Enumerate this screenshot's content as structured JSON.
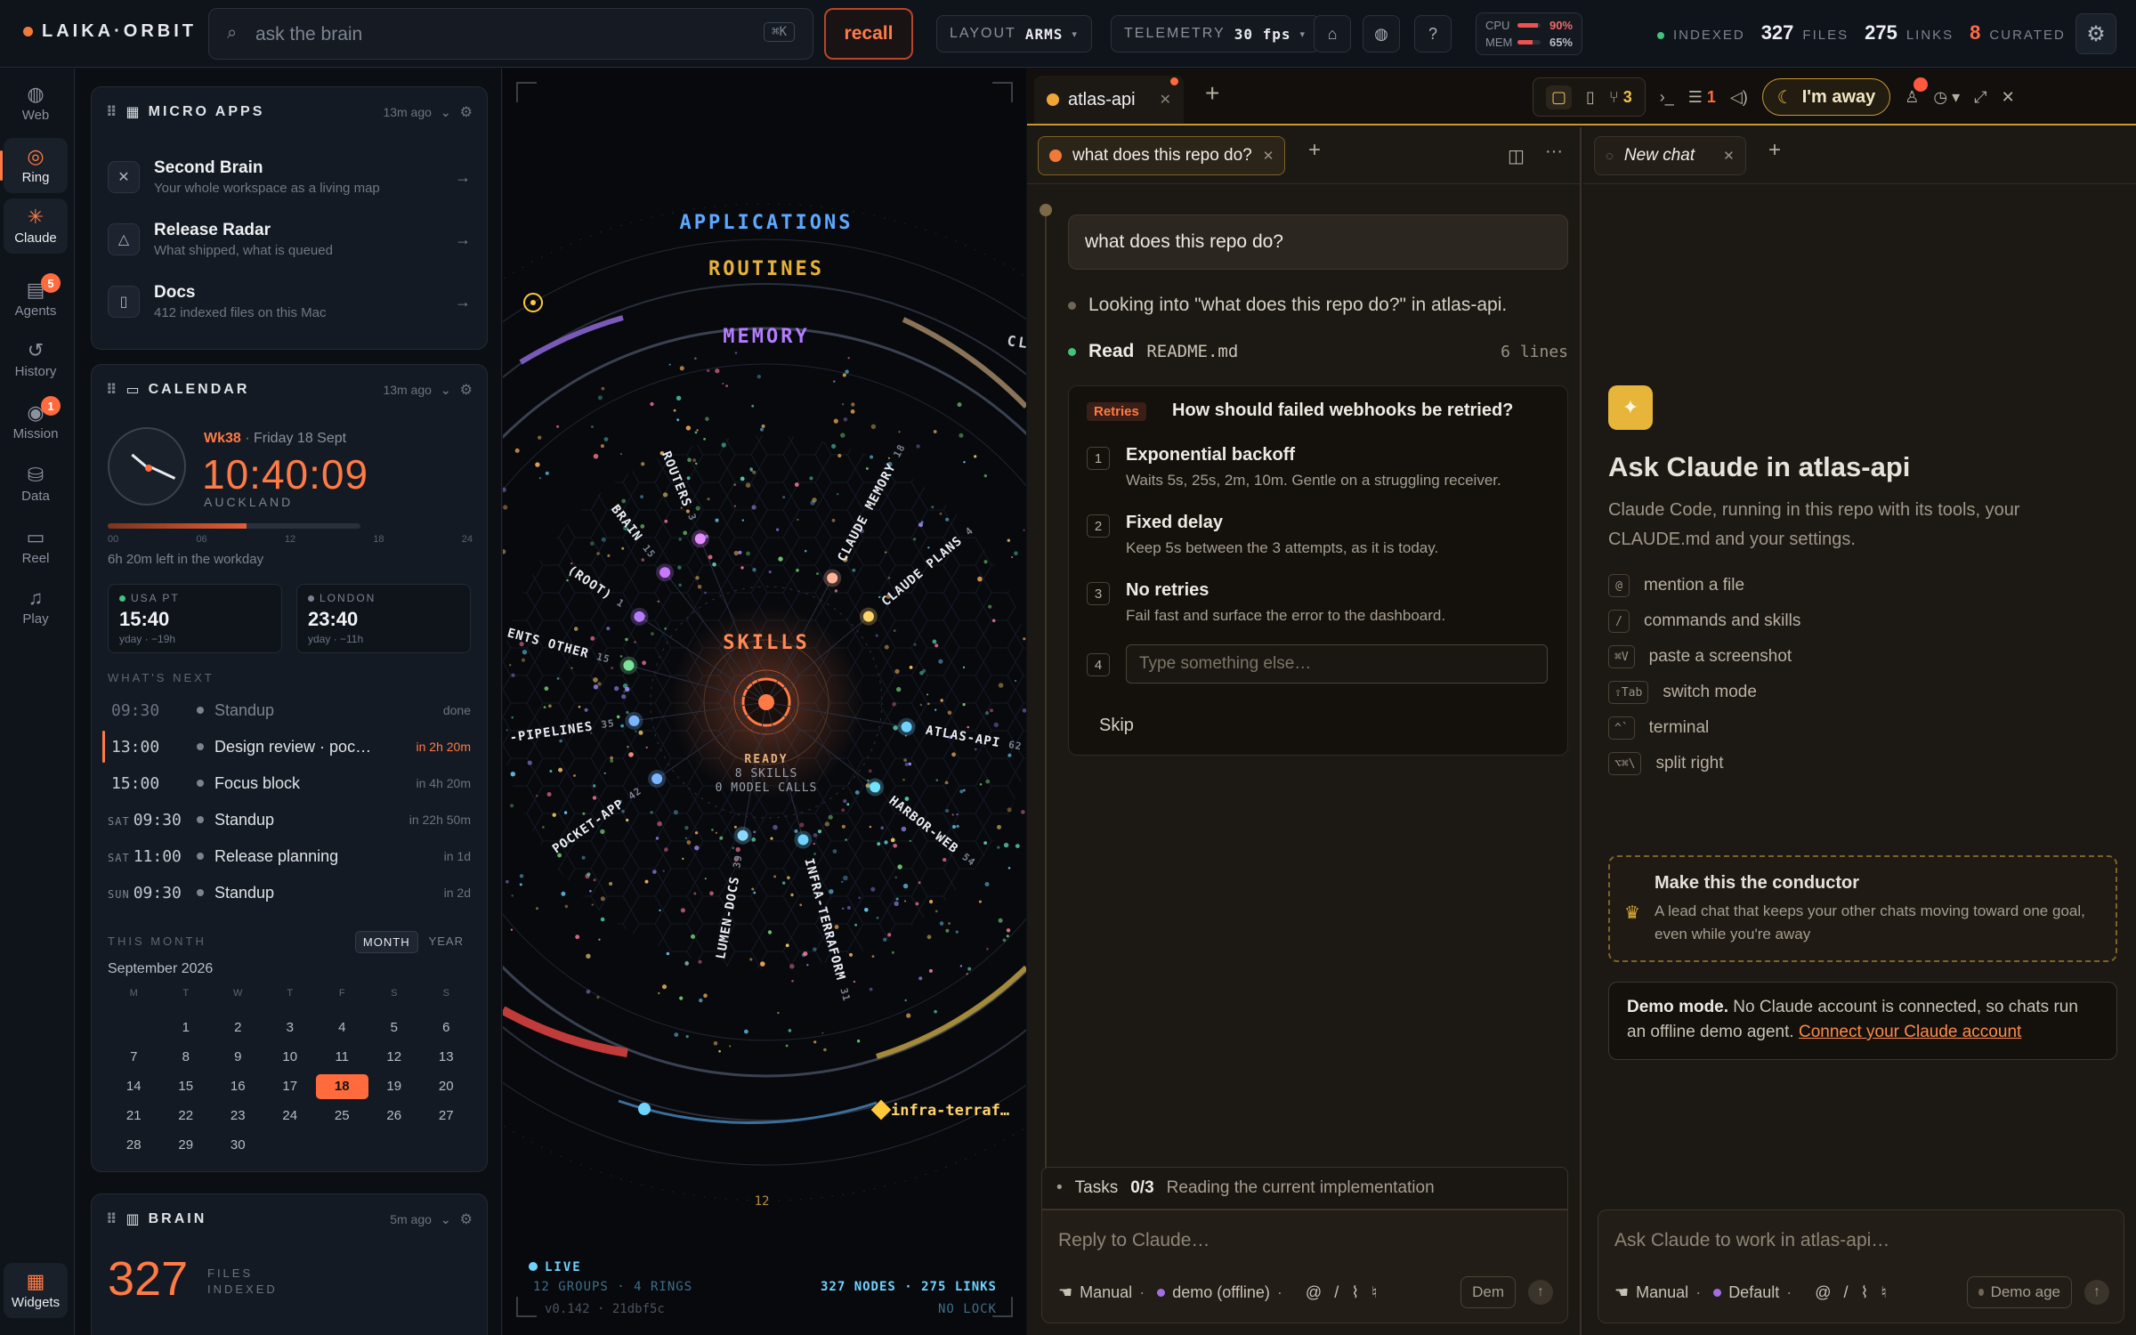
{
  "topbar": {
    "logo": "LAIKA·ORBIT",
    "search_placeholder": "ask the brain",
    "search_kbd": "⌘K",
    "recall": "recall",
    "layout_label": "LAYOUT",
    "layout_value": "ARMS",
    "telemetry_label": "TELEMETRY",
    "telemetry_value": "30 fps",
    "cpu_label": "CPU",
    "cpu_pct": "90%",
    "cpu_value": 0.9,
    "mem_label": "MEM",
    "mem_pct": "65%",
    "mem_value": 0.65,
    "indexed_label": "INDEXED",
    "files_count": "327",
    "files_label": "FILES",
    "links_count": "275",
    "links_label": "LINKS",
    "curated_count": "8",
    "curated_label": "CURATED",
    "accent": "#ff7a45"
  },
  "rail": [
    {
      "label": "Web",
      "icon": "globe-icon"
    },
    {
      "label": "Ring",
      "icon": "ring-icon"
    },
    {
      "label": "Claude",
      "icon": "claude-icon"
    },
    {
      "label": "Agents",
      "icon": "agents-icon",
      "badge": "5"
    },
    {
      "label": "History",
      "icon": "history-icon"
    },
    {
      "label": "Mission",
      "icon": "mission-icon",
      "badge": "1"
    },
    {
      "label": "Data",
      "icon": "database-icon"
    },
    {
      "label": "Reel",
      "icon": "reel-icon"
    },
    {
      "label": "Play",
      "icon": "music-icon"
    },
    {
      "label": "Widgets",
      "icon": "widgets-icon"
    }
  ],
  "microapps": {
    "title": "MICRO APPS",
    "ago": "13m ago",
    "items": [
      {
        "title": "Second Brain",
        "sub": "Your whole workspace as a living map"
      },
      {
        "title": "Release Radar",
        "sub": "What shipped, what is queued"
      },
      {
        "title": "Docs",
        "sub": "412 indexed files on this Mac"
      }
    ]
  },
  "calendar": {
    "title": "CALENDAR",
    "ago": "13m ago",
    "week": "Wk38",
    "date": "· Friday 18 Sept",
    "time": "10:40:09",
    "city": "AUCKLAND",
    "day_progress": 0.55,
    "ticks": [
      "00",
      "06",
      "12",
      "18",
      "24"
    ],
    "left": "6h 20m left in the workday",
    "zones": [
      {
        "name": "USA PT",
        "time": "15:40",
        "sub": "yday · −19h",
        "color": "#43c27b"
      },
      {
        "name": "LONDON",
        "time": "23:40",
        "sub": "yday · −11h",
        "color": "#7b8390"
      }
    ],
    "next_label": "WHAT'S NEXT",
    "events": [
      {
        "day": "",
        "time": "09:30",
        "title": "Standup",
        "rel": "done"
      },
      {
        "day": "",
        "time": "13:00",
        "title": "Design review · poc…",
        "rel": "in 2h 20m"
      },
      {
        "day": "",
        "time": "15:00",
        "title": "Focus block",
        "rel": "in 4h 20m"
      },
      {
        "day": "SAT",
        "time": "09:30",
        "title": "Standup",
        "rel": "in 22h 50m"
      },
      {
        "day": "SAT",
        "time": "11:00",
        "title": "Release planning",
        "rel": "in 1d"
      },
      {
        "day": "SUN",
        "time": "09:30",
        "title": "Standup",
        "rel": "in 2d"
      }
    ],
    "month_label": "THIS MONTH",
    "toggle": [
      "MONTH",
      "YEAR"
    ],
    "month_name": "September 2026",
    "weekdays": [
      "M",
      "T",
      "W",
      "T",
      "F",
      "S",
      "S"
    ],
    "weeks": [
      [
        "",
        "1",
        "2",
        "3",
        "4",
        "5",
        "6"
      ],
      [
        "7",
        "8",
        "9",
        "10",
        "11",
        "12",
        "13"
      ],
      [
        "14",
        "15",
        "16",
        "17",
        "18",
        "19",
        "20"
      ],
      [
        "21",
        "22",
        "23",
        "24",
        "25",
        "26",
        "27"
      ],
      [
        "28",
        "29",
        "30",
        "",
        "",
        "",
        ""
      ]
    ],
    "today": "18"
  },
  "brain": {
    "title": "BRAIN",
    "ago": "5m ago",
    "count": "327",
    "l1": "FILES",
    "l2": "INDEXED"
  },
  "ring": {
    "ring_labels": [
      "APPLICATIONS",
      "ROUTINES",
      "MEMORY",
      "CLAUDE"
    ],
    "center": "SKILLS",
    "center_status": "READY",
    "center_l1": "8 SKILLS",
    "center_l2": "0 MODEL CALLS",
    "arms": [
      {
        "label": "ROUTERS",
        "count": "3"
      },
      {
        "label": "BRAIN",
        "count": "15"
      },
      {
        "label": "(ROOT)",
        "count": "1"
      },
      {
        "label": "ENTS OTHER",
        "count": "15"
      },
      {
        "label": "-PIPELINES",
        "count": "35"
      },
      {
        "label": "POCKET-APP",
        "count": "42"
      },
      {
        "label": "LUMEN-DOCS",
        "count": "39"
      },
      {
        "label": "INFRA-TERRAFORM",
        "count": "31"
      },
      {
        "label": "HARBOR-WEB",
        "count": "54"
      },
      {
        "label": "ATLAS-API",
        "count": "62"
      },
      {
        "label": "CLAUDE PLANS",
        "count": "4"
      },
      {
        "label": "CLAUDE MEMORY",
        "count": "18"
      }
    ],
    "pin": "infra-terraf…",
    "bottom_num": "12",
    "live": "LIVE",
    "groups": "12 GROUPS · 4 RINGS",
    "nodes": "327 NODES · 275 LINKS",
    "version": "v0.142 · 21dbf5c",
    "lock": "NO LOCK"
  },
  "chat": {
    "tab": "atlas-api",
    "branches": "3",
    "list_count": "1",
    "away": "I'm away",
    "pane1": {
      "tab": "what does this repo do?",
      "question": "what does this repo do?",
      "looking": "Looking into \"what does this repo do?\" in atlas-api.",
      "read": "Read",
      "read_file": "README.md",
      "read_lines": "6 lines",
      "q_tag": "Retries",
      "q_title": "How should failed webhooks be retried?",
      "options": [
        {
          "n": "1",
          "t": "Exponential backoff",
          "s": "Waits 5s, 25s, 2m, 10m. Gentle on a struggling receiver."
        },
        {
          "n": "2",
          "t": "Fixed delay",
          "s": "Keep 5s between the 3 attempts, as it is today."
        },
        {
          "n": "3",
          "t": "No retries",
          "s": "Fail fast and surface the error to the dashboard."
        }
      ],
      "opt4_n": "4",
      "opt4_ph": "Type something else…",
      "skip": "Skip",
      "tasks_label": "Tasks",
      "tasks_count": "0/3",
      "tasks_text": "Reading the current implementation",
      "reply_ph": "Reply to Claude…",
      "mode": "Manual",
      "model": "demo (offline)",
      "tag": "Dem"
    },
    "pane2": {
      "tab": "New chat",
      "heading": "Ask Claude in atlas-api",
      "sub": "Claude Code, running in this repo with its tools, your CLAUDE.md and your settings.",
      "shortcuts": [
        {
          "k": "@",
          "t": "mention a file"
        },
        {
          "k": "/",
          "t": "commands and skills"
        },
        {
          "k": "⌘V",
          "t": "paste a screenshot"
        },
        {
          "k": "⇧Tab",
          "t": "switch mode"
        },
        {
          "k": "^`",
          "t": "terminal"
        },
        {
          "k": "⌥⌘\\",
          "t": "split right"
        }
      ],
      "cond_title": "Make this the conductor",
      "cond_sub": "A lead chat that keeps your other chats moving toward one goal, even while you're away",
      "demo_bold": "Demo mode.",
      "demo_text": " No Claude account is connected, so chats run an offline demo agent. ",
      "demo_link": "Connect your Claude account",
      "input_ph": "Ask Claude to work in atlas-api…",
      "mode": "Manual",
      "model": "Default",
      "tag": "Demo age"
    }
  }
}
